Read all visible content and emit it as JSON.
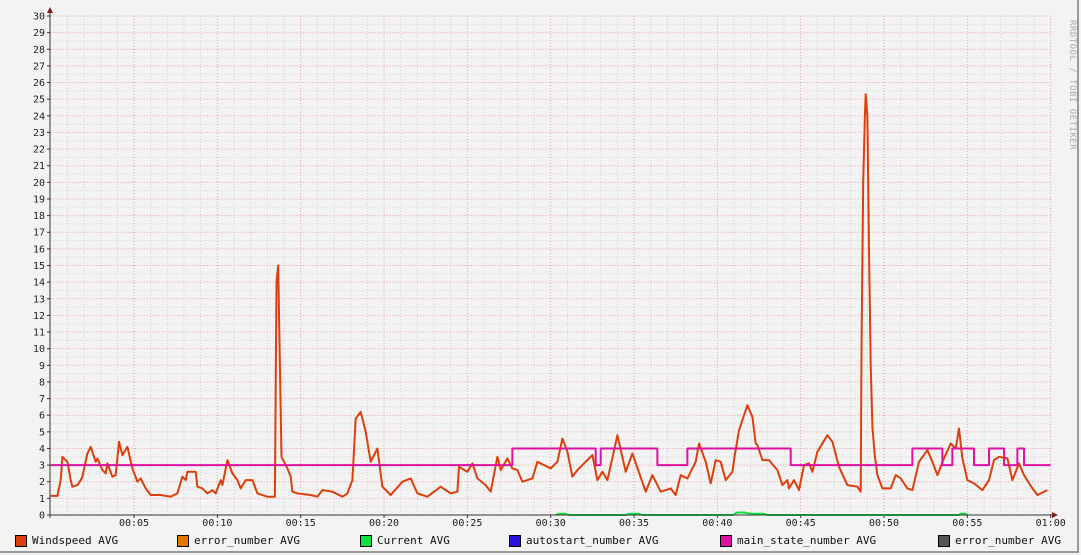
{
  "watermark": "RRDTOOL / TOBI OETIKER",
  "chart_data": {
    "type": "line",
    "title": "",
    "xlabel": "",
    "ylabel": "",
    "xlim_minutes": [
      0,
      60
    ],
    "ylim": [
      0,
      30
    ],
    "yticks": [
      0,
      1,
      2,
      3,
      4,
      5,
      6,
      7,
      8,
      9,
      10,
      11,
      12,
      13,
      14,
      15,
      16,
      17,
      18,
      19,
      20,
      21,
      22,
      23,
      24,
      25,
      26,
      27,
      28,
      29,
      30
    ],
    "xticks": [
      {
        "minute": 5,
        "label": "00:05"
      },
      {
        "minute": 10,
        "label": "00:10"
      },
      {
        "minute": 15,
        "label": "00:15"
      },
      {
        "minute": 20,
        "label": "00:20"
      },
      {
        "minute": 25,
        "label": "00:25"
      },
      {
        "minute": 30,
        "label": "00:30"
      },
      {
        "minute": 35,
        "label": "00:35"
      },
      {
        "minute": 40,
        "label": "00:40"
      },
      {
        "minute": 45,
        "label": "00:45"
      },
      {
        "minute": 50,
        "label": "00:50"
      },
      {
        "minute": 55,
        "label": "00:55"
      },
      {
        "minute": 60,
        "label": "01:00"
      }
    ],
    "grid": true,
    "legend_placement": "bottom",
    "legend": [
      {
        "name": "Windspeed AVG",
        "color": "#dd3f0a"
      },
      {
        "name": "error_number AVG",
        "color": "#e07800"
      },
      {
        "name": "Current AVG",
        "color": "#10e040"
      },
      {
        "name": "autostart_number AVG",
        "color": "#2a10e0"
      },
      {
        "name": "main_state_number AVG",
        "color": "#e010a0"
      },
      {
        "name": "error_number AVG",
        "color": "#555555"
      }
    ],
    "series": [
      {
        "name": "Windspeed AVG",
        "color": "#dd3f0a",
        "style": "line",
        "points": [
          [
            0,
            1.15
          ],
          [
            0.4,
            1.15
          ],
          [
            0.6,
            2.1
          ],
          [
            0.7,
            3.5
          ],
          [
            1.0,
            3.2
          ],
          [
            1.2,
            2.1
          ],
          [
            1.3,
            1.7
          ],
          [
            1.6,
            1.8
          ],
          [
            1.8,
            2.1
          ],
          [
            1.9,
            2.3
          ],
          [
            2.2,
            3.7
          ],
          [
            2.4,
            4.1
          ],
          [
            2.7,
            3.2
          ],
          [
            2.8,
            3.4
          ],
          [
            3.1,
            2.7
          ],
          [
            3.3,
            2.5
          ],
          [
            3.4,
            3.1
          ],
          [
            3.7,
            2.3
          ],
          [
            3.9,
            2.4
          ],
          [
            4.1,
            4.4
          ],
          [
            4.3,
            3.6
          ],
          [
            4.6,
            4.1
          ],
          [
            4.9,
            2.8
          ],
          [
            5.2,
            2.0
          ],
          [
            5.4,
            2.2
          ],
          [
            5.7,
            1.6
          ],
          [
            6.0,
            1.2
          ],
          [
            6.6,
            1.2
          ],
          [
            7.2,
            1.1
          ],
          [
            7.6,
            1.3
          ],
          [
            7.9,
            2.3
          ],
          [
            8.1,
            2.1
          ],
          [
            8.2,
            2.6
          ],
          [
            8.7,
            2.6
          ],
          [
            8.8,
            1.7
          ],
          [
            9.1,
            1.6
          ],
          [
            9.4,
            1.3
          ],
          [
            9.7,
            1.5
          ],
          [
            9.9,
            1.3
          ],
          [
            10.2,
            2.1
          ],
          [
            10.3,
            1.8
          ],
          [
            10.6,
            3.3
          ],
          [
            10.9,
            2.5
          ],
          [
            11.2,
            2.1
          ],
          [
            11.4,
            1.6
          ],
          [
            11.7,
            2.1
          ],
          [
            12.1,
            2.1
          ],
          [
            12.4,
            1.3
          ],
          [
            13.0,
            1.1
          ],
          [
            13.45,
            1.1
          ],
          [
            13.55,
            14
          ],
          [
            13.65,
            15
          ],
          [
            13.75,
            9
          ],
          [
            13.85,
            3.5
          ],
          [
            14.2,
            2.8
          ],
          [
            14.4,
            2.3
          ],
          [
            14.5,
            1.4
          ],
          [
            14.8,
            1.3
          ],
          [
            15.6,
            1.2
          ],
          [
            16.0,
            1.1
          ],
          [
            16.3,
            1.5
          ],
          [
            16.9,
            1.4
          ],
          [
            17.5,
            1.1
          ],
          [
            17.8,
            1.3
          ],
          [
            18.1,
            2.1
          ],
          [
            18.3,
            5.8
          ],
          [
            18.6,
            6.2
          ],
          [
            18.9,
            5.0
          ],
          [
            19.2,
            3.2
          ],
          [
            19.6,
            4.0
          ],
          [
            19.9,
            1.7
          ],
          [
            20.4,
            1.2
          ],
          [
            21.1,
            2.0
          ],
          [
            21.6,
            2.2
          ],
          [
            22.0,
            1.3
          ],
          [
            22.6,
            1.1
          ],
          [
            23.4,
            1.7
          ],
          [
            24.0,
            1.3
          ],
          [
            24.4,
            1.4
          ],
          [
            24.5,
            2.9
          ],
          [
            25.0,
            2.6
          ],
          [
            25.3,
            3.1
          ],
          [
            25.6,
            2.2
          ],
          [
            26.1,
            1.8
          ],
          [
            26.4,
            1.4
          ],
          [
            26.8,
            3.5
          ],
          [
            27.0,
            2.7
          ],
          [
            27.4,
            3.4
          ],
          [
            27.7,
            2.8
          ],
          [
            28.0,
            2.7
          ],
          [
            28.3,
            2.0
          ],
          [
            28.9,
            2.2
          ],
          [
            29.2,
            3.2
          ],
          [
            30.0,
            2.8
          ],
          [
            30.4,
            3.2
          ],
          [
            30.7,
            4.6
          ],
          [
            31.0,
            3.8
          ],
          [
            31.3,
            2.3
          ],
          [
            31.6,
            2.7
          ],
          [
            31.9,
            3.0
          ],
          [
            32.5,
            3.6
          ],
          [
            32.8,
            2.1
          ],
          [
            33.1,
            2.6
          ],
          [
            33.4,
            2.1
          ],
          [
            34.0,
            4.8
          ],
          [
            34.5,
            2.6
          ],
          [
            34.9,
            3.7
          ],
          [
            35.7,
            1.4
          ],
          [
            36.1,
            2.4
          ],
          [
            36.6,
            1.4
          ],
          [
            37.2,
            1.6
          ],
          [
            37.5,
            1.2
          ],
          [
            37.8,
            2.4
          ],
          [
            38.2,
            2.2
          ],
          [
            38.7,
            3.2
          ],
          [
            38.9,
            4.3
          ],
          [
            39.3,
            3.2
          ],
          [
            39.6,
            1.9
          ],
          [
            39.9,
            3.3
          ],
          [
            40.2,
            3.2
          ],
          [
            40.5,
            2.1
          ],
          [
            40.9,
            2.6
          ],
          [
            41.0,
            3.3
          ],
          [
            41.3,
            5.1
          ],
          [
            41.8,
            6.6
          ],
          [
            42.1,
            5.9
          ],
          [
            42.3,
            4.3
          ],
          [
            42.4,
            4.2
          ],
          [
            42.7,
            3.3
          ],
          [
            43.1,
            3.3
          ],
          [
            43.6,
            2.7
          ],
          [
            43.9,
            1.8
          ],
          [
            44.2,
            2.1
          ],
          [
            44.3,
            1.6
          ],
          [
            44.6,
            2.1
          ],
          [
            44.9,
            1.5
          ],
          [
            45.2,
            3.0
          ],
          [
            45.5,
            3.1
          ],
          [
            45.7,
            2.6
          ],
          [
            46.0,
            3.8
          ],
          [
            46.6,
            4.8
          ],
          [
            46.9,
            4.4
          ],
          [
            47.3,
            2.9
          ],
          [
            47.8,
            1.8
          ],
          [
            48.4,
            1.7
          ],
          [
            48.6,
            1.4
          ],
          [
            48.65,
            10
          ],
          [
            48.75,
            20
          ],
          [
            48.85,
            24
          ],
          [
            48.9,
            25.3
          ],
          [
            49.0,
            24
          ],
          [
            49.1,
            16
          ],
          [
            49.2,
            9
          ],
          [
            49.3,
            5.3
          ],
          [
            49.45,
            3.5
          ],
          [
            49.6,
            2.4
          ],
          [
            49.9,
            1.6
          ],
          [
            50.4,
            1.6
          ],
          [
            50.7,
            2.4
          ],
          [
            51.0,
            2.2
          ],
          [
            51.4,
            1.6
          ],
          [
            51.7,
            1.5
          ],
          [
            52.1,
            3.2
          ],
          [
            52.6,
            3.9
          ],
          [
            52.9,
            3.2
          ],
          [
            53.2,
            2.4
          ],
          [
            53.6,
            3.4
          ],
          [
            54.0,
            4.3
          ],
          [
            54.3,
            4.0
          ],
          [
            54.5,
            5.2
          ],
          [
            54.7,
            3.4
          ],
          [
            55.0,
            2.1
          ],
          [
            55.4,
            1.9
          ],
          [
            55.9,
            1.5
          ],
          [
            56.3,
            2.1
          ],
          [
            56.6,
            3.3
          ],
          [
            56.9,
            3.5
          ],
          [
            57.4,
            3.4
          ],
          [
            57.7,
            2.1
          ],
          [
            58.1,
            3.1
          ],
          [
            58.4,
            2.4
          ],
          [
            58.9,
            1.6
          ],
          [
            59.2,
            1.2
          ],
          [
            59.8,
            1.5
          ]
        ]
      },
      {
        "name": "main_state_number AVG",
        "color": "#e010a0",
        "style": "step",
        "points": [
          [
            0,
            3
          ],
          [
            27.7,
            4
          ],
          [
            32.7,
            3
          ],
          [
            33.0,
            4
          ],
          [
            36.4,
            3
          ],
          [
            38.2,
            4
          ],
          [
            44.4,
            3
          ],
          [
            51.7,
            4
          ],
          [
            53.5,
            3
          ],
          [
            54.1,
            4
          ],
          [
            55.4,
            3
          ],
          [
            56.3,
            4
          ],
          [
            57.2,
            3
          ],
          [
            58.0,
            4
          ],
          [
            58.4,
            3
          ],
          [
            60,
            3
          ]
        ]
      },
      {
        "name": "Current AVG",
        "color": "#10e040",
        "style": "line",
        "points": [
          [
            30.3,
            0
          ],
          [
            30.5,
            0.08
          ],
          [
            30.9,
            0.08
          ],
          [
            31.1,
            0
          ],
          [
            34.5,
            0
          ],
          [
            34.7,
            0.08
          ],
          [
            35.3,
            0.08
          ],
          [
            35.5,
            0
          ],
          [
            40.9,
            0
          ],
          [
            41.2,
            0.15
          ],
          [
            41.6,
            0.15
          ],
          [
            42.0,
            0.07
          ],
          [
            42.8,
            0.07
          ],
          [
            43.0,
            0
          ],
          [
            54.5,
            0
          ],
          [
            54.6,
            0.07
          ],
          [
            54.9,
            0.07
          ],
          [
            55.0,
            0
          ]
        ]
      }
    ]
  }
}
